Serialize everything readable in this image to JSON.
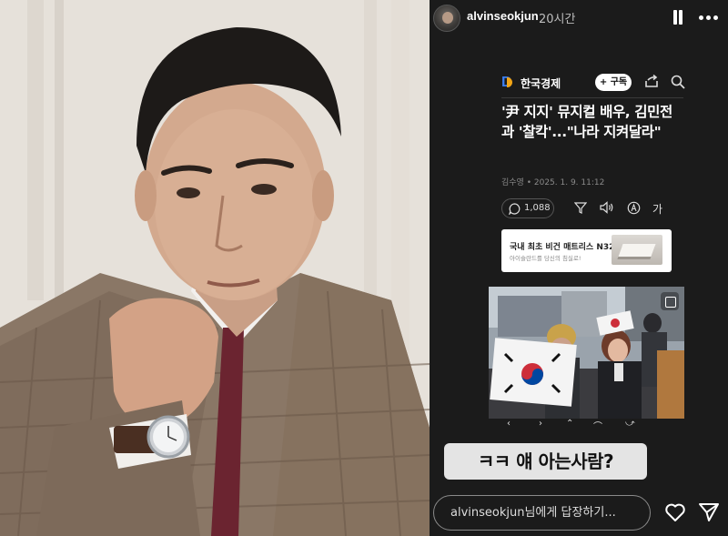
{
  "story": {
    "username": "alvinseokjun",
    "time": "20시간",
    "reply": {
      "username": "alvinseokjun",
      "suffix": "님에게 답장하기..."
    },
    "caption": "ㅋㅋ 얘 아는사람?"
  },
  "news": {
    "brand": "한국경제",
    "subscribe": "+ 구독",
    "headline": "'尹 지지' 뮤지컬 배우, 김민전과 '찰칵'...\"나라 지켜달라\"",
    "byline": "김수영 • 2025. 1. 9. 11:12",
    "comments": "1,088",
    "font_tool": "가",
    "ad": {
      "title": "국내 최초 비건 매트리스 N32",
      "subtitle": "아이슬란드를 당신의 침실로!"
    },
    "photo_nav": [
      "‹",
      "›",
      "⌃",
      "⌒",
      "⤻"
    ]
  },
  "colors": {
    "story_bg": "#1b1b1b",
    "caption_bg": "#e4e4e4",
    "logo_blue": "#3b7ef0",
    "logo_orange": "#f2a516"
  },
  "icons": [
    "pause-icon",
    "more-icon",
    "share-icon",
    "search-icon",
    "comment-icon",
    "filter-icon",
    "speaker-icon",
    "translate-icon",
    "expand-icon",
    "heart-icon",
    "send-icon"
  ]
}
